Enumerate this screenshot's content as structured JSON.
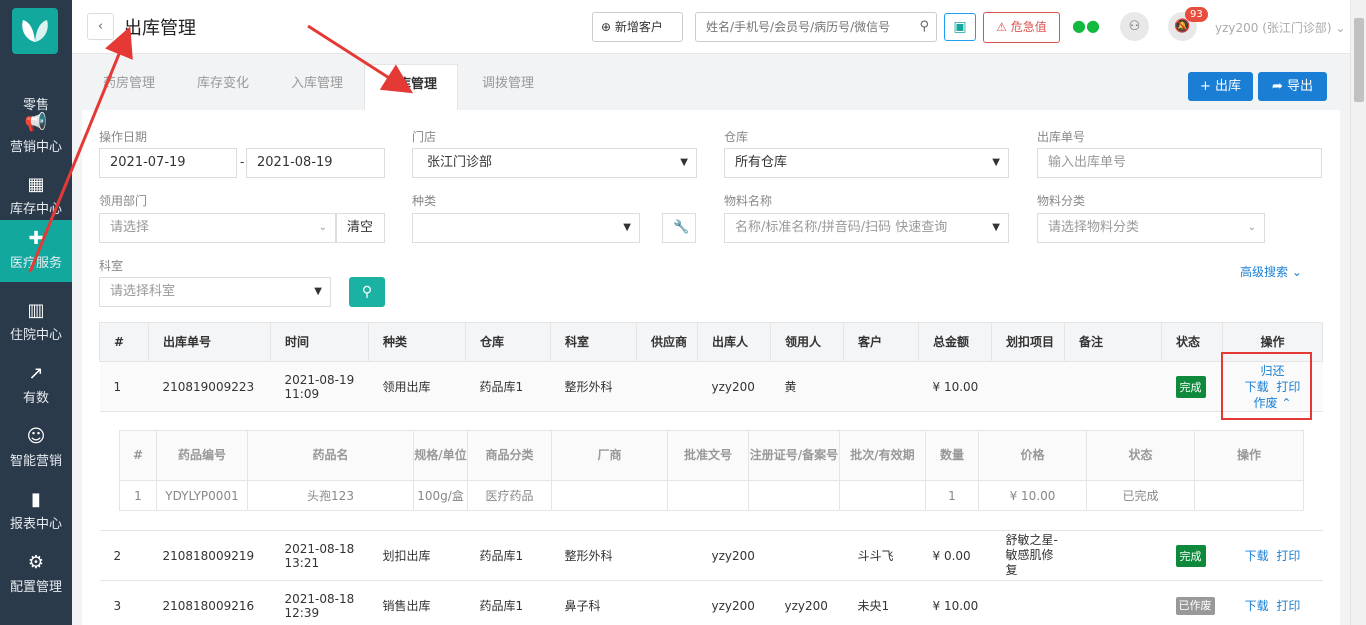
{
  "header": {
    "title": "出库管理",
    "new_customer": "新增客户",
    "search_placeholder": "姓名/手机号/会员号/病历号/微信号",
    "danger_label": "危急值",
    "notif_count": "93",
    "user": "yzy200 (张江门诊部)"
  },
  "sidebar": {
    "items": [
      {
        "label": "零售"
      },
      {
        "label": "营销中心"
      },
      {
        "label": "库存中心"
      },
      {
        "label": "医疗服务"
      },
      {
        "label": "住院中心"
      },
      {
        "label": "有数"
      },
      {
        "label": "智能营销"
      },
      {
        "label": "报表中心"
      },
      {
        "label": "配置管理"
      }
    ]
  },
  "tabs": [
    {
      "label": "药房管理"
    },
    {
      "label": "库存变化"
    },
    {
      "label": "入库管理"
    },
    {
      "label": "出库管理"
    },
    {
      "label": "调拨管理"
    }
  ],
  "actions": {
    "out": "出库",
    "export": "导出"
  },
  "filters": {
    "op_date_label": "操作日期",
    "date_from": "2021-07-19",
    "date_sep": "-",
    "date_to": "2021-08-19",
    "store_label": "门店",
    "store_value": "张江门诊部",
    "warehouse_label": "仓库",
    "warehouse_value": "所有仓库",
    "out_no_label": "出库单号",
    "out_no_placeholder": "输入出库单号",
    "dept_label": "领用部门",
    "dept_placeholder": "请选择",
    "clear": "清空",
    "kind_label": "种类",
    "material_name_label": "物料名称",
    "material_name_placeholder": "名称/标准名称/拼音码/扫码 快速查询",
    "material_cat_label": "物料分类",
    "material_cat_placeholder": "请选择物料分类",
    "office_label": "科室",
    "office_placeholder": "请选择科室",
    "advanced": "高级搜索"
  },
  "table": {
    "headers": [
      "#",
      "出库单号",
      "时间",
      "种类",
      "仓库",
      "科室",
      "供应商",
      "出库人",
      "领用人",
      "客户",
      "总金额",
      "划扣项目",
      "备注",
      "状态",
      "操作"
    ],
    "rows": [
      {
        "idx": "1",
        "no": "210819009223",
        "time": "2021-08-19 11:09",
        "kind": "领用出库",
        "wh": "药品库1",
        "office": "整形外科",
        "supplier": "",
        "out_by": "yzy200",
        "taker": "黄",
        "customer": "",
        "amount": "¥ 10.00",
        "item": "",
        "remark": "",
        "status": "完成",
        "ops": [
          "归还",
          "下载",
          "打印",
          "作废"
        ]
      },
      {
        "idx": "2",
        "no": "210818009219",
        "time": "2021-08-18 13:21",
        "kind": "划扣出库",
        "wh": "药品库1",
        "office": "整形外科",
        "supplier": "",
        "out_by": "yzy200",
        "taker": "",
        "customer": "斗斗飞",
        "amount": "¥ 0.00",
        "item": "舒敏之星-敏感肌修复",
        "remark": "",
        "status": "完成",
        "ops": [
          "下载",
          "打印"
        ]
      },
      {
        "idx": "3",
        "no": "210818009216",
        "time": "2021-08-18 12:39",
        "kind": "销售出库",
        "wh": "药品库1",
        "office": "鼻子科",
        "supplier": "",
        "out_by": "yzy200",
        "taker": "yzy200",
        "customer": "未央1",
        "amount": "¥ 10.00",
        "item": "",
        "remark": "",
        "status": "已作废",
        "ops": [
          "下载",
          "打印"
        ]
      }
    ]
  },
  "sub_table": {
    "headers": [
      "#",
      "药品编号",
      "药品名",
      "规格/单位",
      "商品分类",
      "厂商",
      "批准文号",
      "注册证号/备案号",
      "批次/有效期",
      "数量",
      "价格",
      "状态",
      "操作"
    ],
    "rows": [
      {
        "idx": "1",
        "code": "YDYLYP0001",
        "name": "头孢123",
        "spec": "100g/盒",
        "cat": "医疗药品",
        "maker": "",
        "approval": "",
        "reg": "",
        "batch": "",
        "qty": "1",
        "price": "¥ 10.00",
        "status": "已完成",
        "op": ""
      }
    ]
  }
}
